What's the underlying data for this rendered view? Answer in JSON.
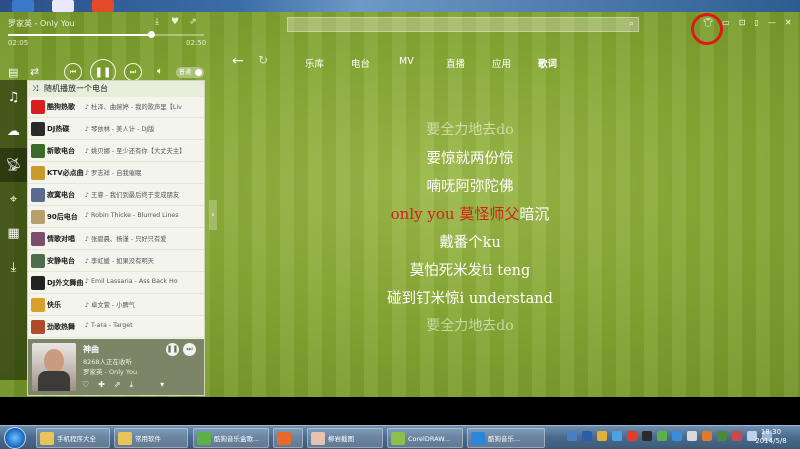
{
  "player": {
    "song_line": "罗家英 - Only You",
    "current_time": "02:05",
    "total_time": "02:50",
    "progress_fraction": 0.73,
    "volume_label": "普通"
  },
  "sidebar": {
    "random_label": "随机播放一个电台",
    "stations": [
      {
        "name": "酷狗热歌",
        "song": "♪ 杜泽、曲婉婷 - 我的歌声里【Liv",
        "color": "#d81e1e"
      },
      {
        "name": "DJ热碟",
        "song": "♪ 琴依林 - 美人计 - DJ版",
        "color": "#2a2a2a"
      },
      {
        "name": "新歌电台",
        "song": "♪ 姚贝娜 - 至少还有你【大丈夫主】",
        "color": "#3b6b2b"
      },
      {
        "name": "KTV必点曲",
        "song": "♪ 罗志祥 - 自我催眠",
        "color": "#c99a2e"
      },
      {
        "name": "寂寞电台",
        "song": "♪ 王睿 - 我们到最后终于变成朋友",
        "color": "#5a6c8e"
      },
      {
        "name": "90后电台",
        "song": "♪ Robin Thicke - Blurred Lines",
        "color": "#b8a06a"
      },
      {
        "name": "情歌对唱",
        "song": "♪ 张碧晨、杨谨 - 只好只有爱",
        "color": "#7a4f6d"
      },
      {
        "name": "安静电台",
        "song": "♪ 李虹媛 - 如果没有明天",
        "color": "#4d6d4d"
      },
      {
        "name": "DJ外文舞曲",
        "song": "♪ Emil Lassaria - Ass Back Ho",
        "color": "#222222"
      },
      {
        "name": "快乐",
        "song": "♪ 卓文萱 - 小脾气",
        "color": "#d9a02c"
      },
      {
        "name": "劲歌热舞",
        "song": "♪ T-ara - Target",
        "color": "#b04a2a"
      }
    ],
    "now_playing": {
      "title": "神曲",
      "listeners": "8268人正在收听",
      "artist_song": "罗家英 - Only You"
    }
  },
  "nav": {
    "tabs": [
      "乐库",
      "电台",
      "MV",
      "直播",
      "应用",
      "歌词"
    ],
    "active_tab": "歌词"
  },
  "lyrics": {
    "lines": [
      {
        "text": "要全力地去do",
        "state": "dim"
      },
      {
        "text": "要惊就两份惊",
        "state": "normal"
      },
      {
        "text": "喃呒阿弥陀佛",
        "state": "normal"
      },
      {
        "text": "戴番个ku",
        "state": "normal"
      },
      {
        "text": "莫怕死米发ti teng",
        "state": "normal"
      },
      {
        "text": "碰到钉米惊i understand",
        "state": "normal"
      },
      {
        "text": "要全力地去do",
        "state": "dim"
      }
    ],
    "current_highlighted": "only you 莫怪师父",
    "current_rest": "暗沉",
    "highlight_color": "#d8201a"
  },
  "taskbar": {
    "items": [
      {
        "label": "手机程序大全",
        "color": "#e8c45a"
      },
      {
        "label": "常用软件",
        "color": "#e8c45a"
      },
      {
        "label": "酷狗音乐盒歌...",
        "color": "#5bb04a"
      },
      {
        "label": "",
        "color": "#e8692a"
      },
      {
        "label": "柳岩截图",
        "color": "#e7c2b0"
      },
      {
        "label": "CorelDRAW...",
        "color": "#8dc04a"
      },
      {
        "label": "酷狗音乐...",
        "color": "#2a86d8"
      }
    ],
    "clock_time": "18:30",
    "clock_date": "2014/5/8"
  },
  "colors": {
    "skin_ring": "#e01818",
    "app_green": "#86a734"
  }
}
